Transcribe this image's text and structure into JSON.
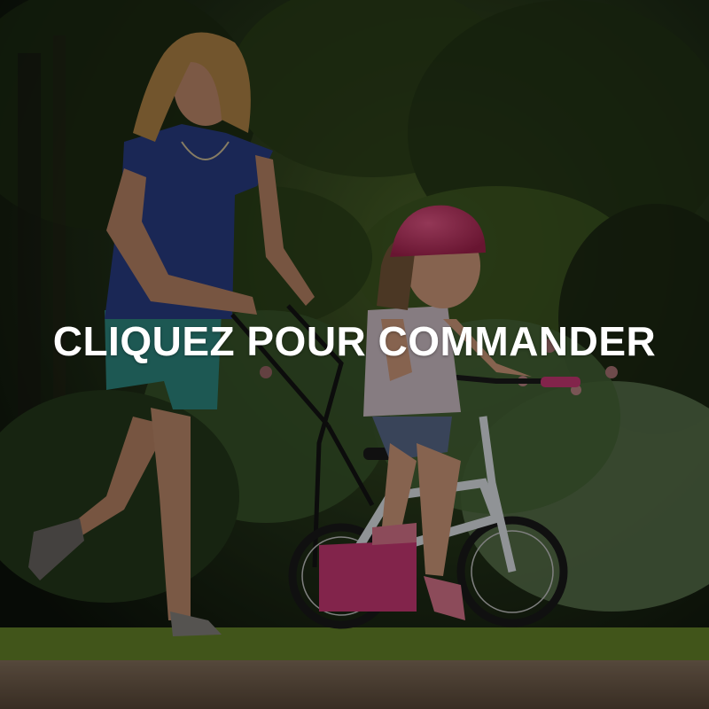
{
  "banner": {
    "cta_text": "CLIQUEZ POUR COMMANDER",
    "photo_icon": "photo-mother-daughter-bike"
  },
  "colors": {
    "text": "#ffffff",
    "overlay": "#000000",
    "helmet": "#d2336b",
    "bike_frame": "#e8eef2",
    "bike_accent": "#d23a7a",
    "shirt": "#2a3f8a",
    "shorts": "#2f8f86",
    "grass": "#6a8a2a",
    "path": "#7a6450"
  }
}
